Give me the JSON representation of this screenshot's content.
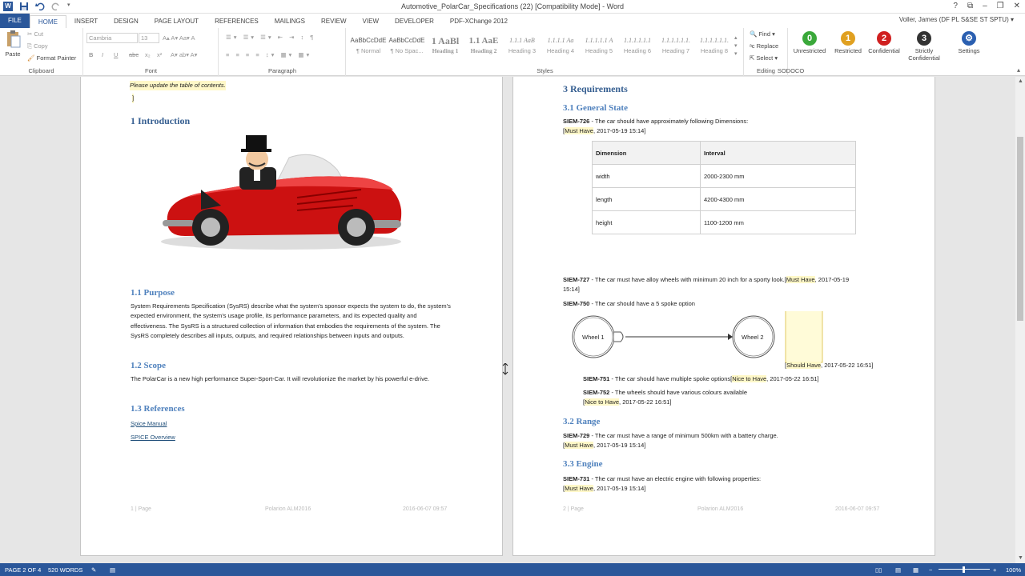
{
  "window": {
    "title": "Automotive_PolarCar_Specifications (22) [Compatibility Mode] - Word",
    "user": "Voller, James (DF PL S&SE ST SPTU)"
  },
  "tabs": [
    "FILE",
    "HOME",
    "INSERT",
    "DESIGN",
    "PAGE LAYOUT",
    "REFERENCES",
    "MAILINGS",
    "REVIEW",
    "VIEW",
    "DEVELOPER",
    "PDF-XChange 2012"
  ],
  "ribbon": {
    "clipboard": {
      "paste": "Paste",
      "cut": "Cut",
      "copy": "Copy",
      "format_painter": "Format Painter",
      "label": "Clipboard"
    },
    "font": {
      "name": "Cambria",
      "size": "13",
      "label": "Font",
      "bold": "B",
      "italic": "I",
      "underline": "U",
      "strike": "abc",
      "sub": "x₂",
      "sup": "x²"
    },
    "paragraph": {
      "label": "Paragraph"
    },
    "styles": {
      "label": "Styles",
      "items": [
        {
          "sample": "AaBbCcDdE",
          "name": "¶ Normal",
          "cls": ""
        },
        {
          "sample": "AaBbCcDdE",
          "name": "¶ No Spac...",
          "cls": ""
        },
        {
          "sample": "1 AaBl",
          "name": "Heading 1",
          "cls": "h1"
        },
        {
          "sample": "1.1 AaE",
          "name": "Heading 2",
          "cls": "h2"
        },
        {
          "sample": "1.1.1 AaB",
          "name": "Heading 3",
          "cls": "hx"
        },
        {
          "sample": "1.1.1.1 Aa",
          "name": "Heading 4",
          "cls": "hx"
        },
        {
          "sample": "1.1.1.1.1 A",
          "name": "Heading 5",
          "cls": "hx"
        },
        {
          "sample": "1.1.1.1.1.1",
          "name": "Heading 6",
          "cls": "hx"
        },
        {
          "sample": "1.1.1.1.1.1.",
          "name": "Heading 7",
          "cls": "hx"
        },
        {
          "sample": "1.1.1.1.1.1.",
          "name": "Heading 8",
          "cls": "hx"
        }
      ]
    },
    "editing": {
      "find": "Find",
      "replace": "Replace",
      "select": "Select",
      "label": "Editing"
    },
    "sodoco": {
      "label": "SODOCO",
      "buttons": [
        {
          "num": "0",
          "label": "Unrestricted",
          "color": "#3aa83a"
        },
        {
          "num": "1",
          "label": "Restricted",
          "color": "#e0a020"
        },
        {
          "num": "2",
          "label": "Confidential",
          "color": "#d02020"
        },
        {
          "num": "3",
          "label": "Strictly Confidential",
          "color": "#333333"
        }
      ],
      "settings": "Settings"
    }
  },
  "page1": {
    "toc_note": "Please update the table of contents.",
    "toc_bracket": "]",
    "h_intro": "1 Introduction",
    "h_purpose": "1.1 Purpose",
    "purpose_text": "System Requirements Specification (SysRS) describe what the system’s sponsor expects the system to do, the system’s expected environment, the system’s usage profile, its performance parameters, and its expected quality and effectiveness. The SysRS is a structured collection of information that embodies the requirements of the system. The SysRS completely describes all inputs, outputs, and required relationships between inputs and outputs.",
    "h_scope": "1.2 Scope",
    "scope_text": "The PolarCar is a new high performance Super-Sport-Car. It will revolutionize the market by his powerful e-drive.",
    "h_refs": "1.3 References",
    "ref1": "Spice Manual",
    "ref2": "SPICE Overview",
    "footer_left": "1 | Page",
    "footer_mid": "Polarion ALM2016",
    "footer_right": "2016-06-07 09:57"
  },
  "page2": {
    "h_req": "3 Requirements",
    "h_general": "3.1 General State",
    "r726_id": "SIEM-726",
    "r726_text": " - The car should have approximately following Dimensions:",
    "r726_tag": "Must Have",
    "r726_date": ", 2017-05-19 15:14]",
    "table_head": [
      "Dimension",
      "Interval"
    ],
    "table_rows": [
      [
        "width",
        "2000-2300 mm"
      ],
      [
        "length",
        "4200-4300 mm"
      ],
      [
        "height",
        "1100-1200 mm"
      ]
    ],
    "r727_id": "SIEM-727",
    "r727_text": " - The car must have alloy wheels with minimum 20 inch for a sporty look.",
    "r727_tag": "Must Have",
    "r727_date": ", 2017-05-19",
    "r727_time": "15:14]",
    "r750_id": "SIEM-750",
    "r750_text": " - The car should have a 5 spoke option",
    "wheel1": "Wheel 1",
    "wheel2": "Wheel 2",
    "should_tag": "Should Have",
    "should_date": ", 2017-05-22 16:51]",
    "r751_id": "SIEM-751",
    "r751_text": " - The car should have multiple spoke options",
    "r751_tag": "Nice to Have",
    "r751_date": ", 2017-05-22 16:51]",
    "r752_id": "SIEM-752",
    "r752_text": " - The wheels should have various colours available",
    "r752_tag": "Nice to Have",
    "r752_date": ", 2017-05-22 16:51]",
    "h_range": "3.2 Range",
    "r729_id": "SIEM-729",
    "r729_text": " - The car must have a range of minimum 500km with a battery charge.",
    "r729_tag": "Must Have",
    "r729_date": ", 2017-05-19 15:14]",
    "h_engine": "3.3 Engine",
    "r731_id": "SIEM-731",
    "r731_text": " - The car must have an electric engine with following properties:",
    "r731_tag": "Must Have",
    "r731_date": ", 2017-05-19 15:14]",
    "footer_left": "2 | Page",
    "footer_mid": "Polarion ALM2016",
    "footer_right": "2016-06-07 09:57"
  },
  "status": {
    "page": "PAGE 2 OF 4",
    "words": "520 WORDS",
    "zoom": "100%"
  }
}
